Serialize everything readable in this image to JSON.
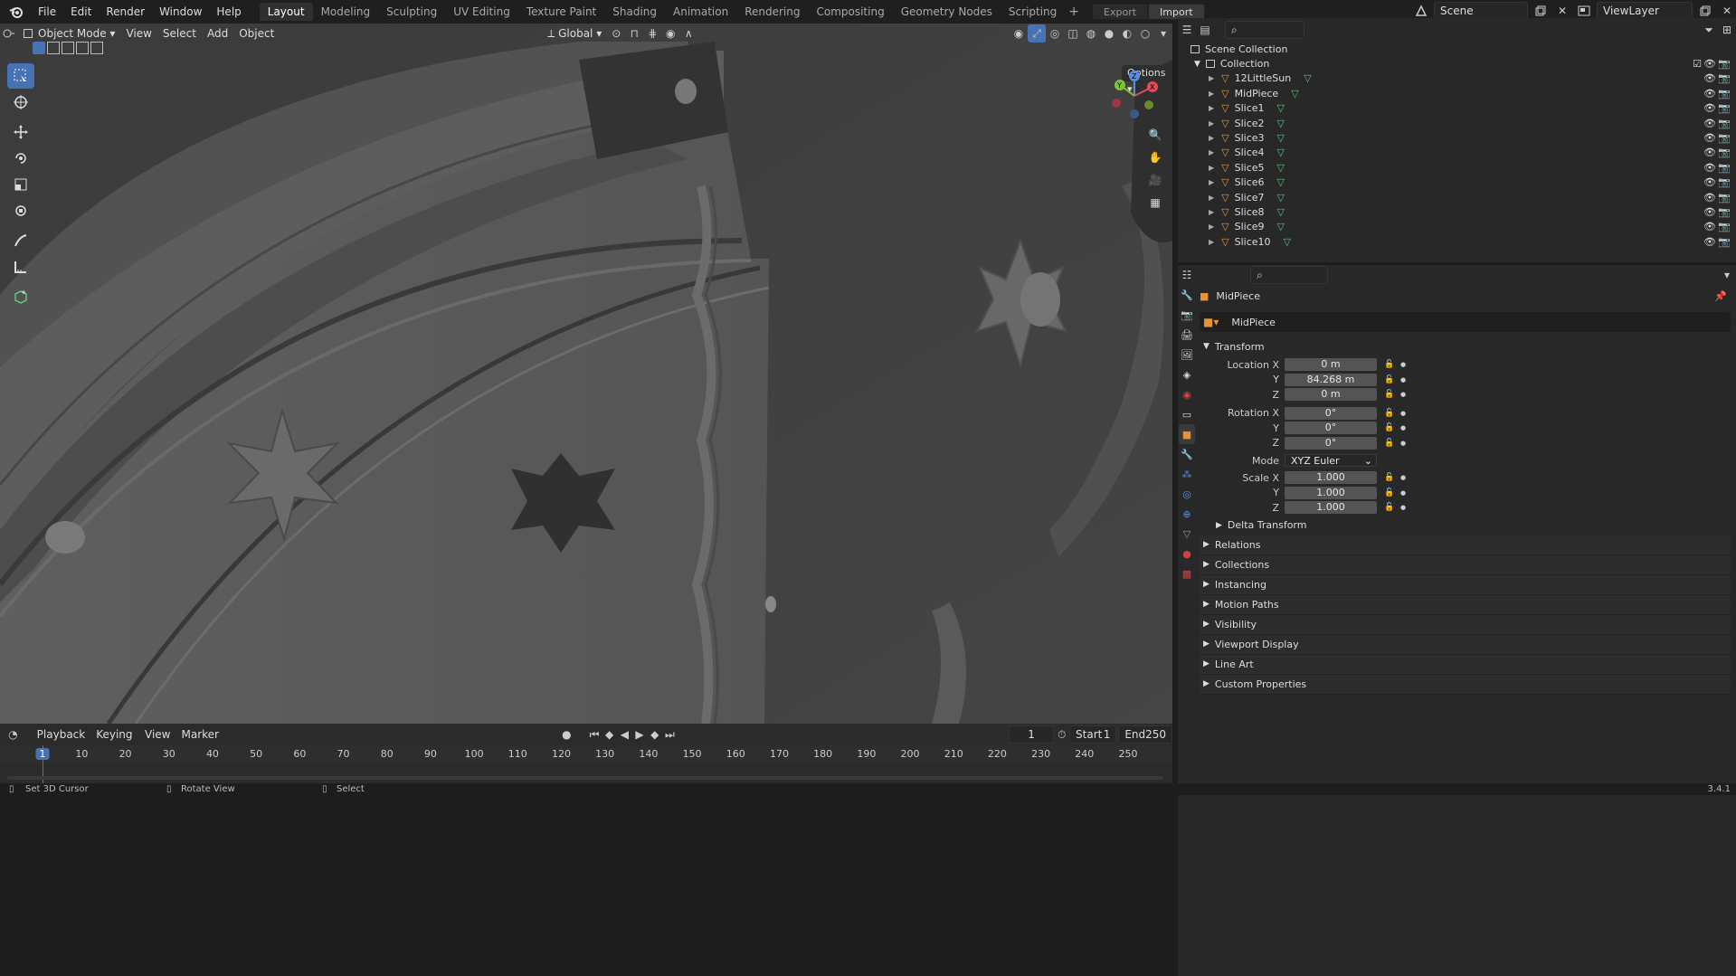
{
  "menu": {
    "file": "File",
    "edit": "Edit",
    "render": "Render",
    "window": "Window",
    "help": "Help"
  },
  "workspaces": [
    "Layout",
    "Modeling",
    "Sculpting",
    "UV Editing",
    "Texture Paint",
    "Shading",
    "Animation",
    "Rendering",
    "Compositing",
    "Geometry Nodes",
    "Scripting"
  ],
  "workspace_active": "Layout",
  "export_label": "Export",
  "import_label": "Import",
  "scene": "Scene",
  "view_layer": "ViewLayer",
  "vp_header": {
    "mode": "Object Mode",
    "view": "View",
    "select": "Select",
    "add": "Add",
    "object": "Object",
    "orientation": "Global",
    "options": "Options"
  },
  "outliner": {
    "scene_collection": "Scene Collection",
    "collection": "Collection",
    "items": [
      "12LittleSun",
      "MidPiece",
      "Slice1",
      "Slice2",
      "Slice3",
      "Slice4",
      "Slice5",
      "Slice6",
      "Slice7",
      "Slice8",
      "Slice9",
      "Slice10"
    ]
  },
  "properties": {
    "object_name": "MidPiece",
    "data_name": "MidPiece",
    "transform": "Transform",
    "location_label": "Location X",
    "loc": [
      "0 m",
      "84.268 m",
      "0 m"
    ],
    "rotation_label": "Rotation X",
    "rot": [
      "0°",
      "0°",
      "0°"
    ],
    "mode_label": "Mode",
    "mode_value": "XYZ Euler",
    "scale_label": "Scale X",
    "scale": [
      "1.000",
      "1.000",
      "1.000"
    ],
    "y": "Y",
    "z": "Z",
    "delta": "Delta Transform",
    "sections": [
      "Relations",
      "Collections",
      "Instancing",
      "Motion Paths",
      "Visibility",
      "Viewport Display",
      "Line Art",
      "Custom Properties"
    ]
  },
  "timeline": {
    "playback": "Playback",
    "keying": "Keying",
    "view": "View",
    "marker": "Marker",
    "current": "1",
    "start_label": "Start",
    "start": "1",
    "end_label": "End",
    "end": "250",
    "ticks": [
      "1",
      "10",
      "20",
      "30",
      "40",
      "50",
      "60",
      "70",
      "80",
      "90",
      "100",
      "110",
      "120",
      "130",
      "140",
      "150",
      "160",
      "170",
      "180",
      "190",
      "200",
      "210",
      "220",
      "230",
      "240",
      "250"
    ]
  },
  "status": {
    "cursor": "Set 3D Cursor",
    "rotate": "Rotate View",
    "select": "Select",
    "version": "3.4.1"
  },
  "gizmo_axes": {
    "z": "Z",
    "y": "Y",
    "x": "X"
  },
  "colors": {
    "accent": "#4772b3",
    "object_orange": "#e69336",
    "mesh_green": "#61c17d"
  }
}
